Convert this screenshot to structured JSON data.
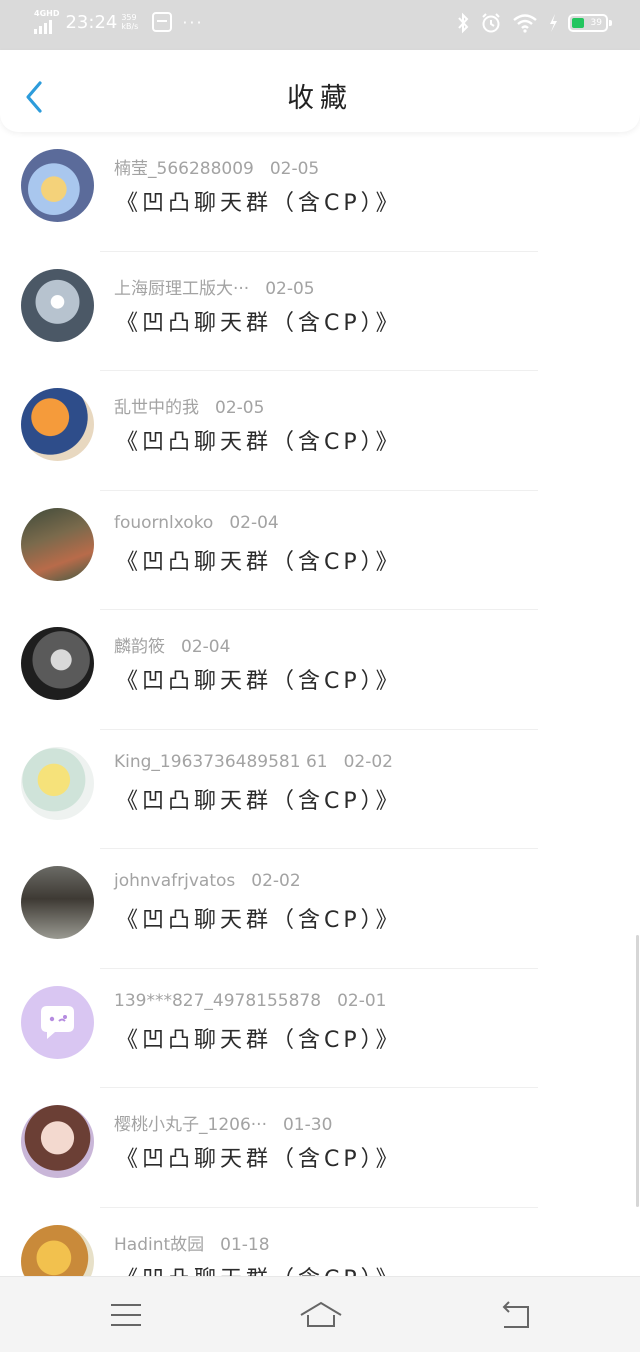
{
  "status_bar": {
    "network": "4GHD",
    "time": "23:24",
    "speed_value": "359",
    "speed_unit": "kB/s",
    "more": "···",
    "battery_level": "39",
    "battery_fraction": 0.39,
    "icons": [
      "signal-icon",
      "sim-card-icon",
      "bluetooth-icon",
      "alarm-icon",
      "wifi-icon",
      "charging-icon",
      "battery-icon"
    ]
  },
  "header": {
    "title": "收藏",
    "back_icon": "chevron-left-icon"
  },
  "colors": {
    "accent": "#2d9cdb",
    "status_bar_bg": "#dadada",
    "battery_fill": "#22c55e",
    "meta_text": "#a3a3a3",
    "message_text": "#2b2b2b"
  },
  "favorites": [
    {
      "name": "楠莹_566288009",
      "date": "02-05",
      "message": "《凹凸聊天群（含CP）》"
    },
    {
      "name": "上海厨理工版大···",
      "date": "02-05",
      "message": "《凹凸聊天群（含CP）》"
    },
    {
      "name": "乱世中的我",
      "date": "02-05",
      "message": "《凹凸聊天群（含CP）》"
    },
    {
      "name": "fouornlxoko",
      "date": "02-04",
      "message": "《凹凸聊天群（含CP）》"
    },
    {
      "name": "麟韵筱",
      "date": "02-04",
      "message": "《凹凸聊天群（含CP）》"
    },
    {
      "name": "King_1963736489581 61",
      "date": "02-02",
      "message": "《凹凸聊天群（含CP）》"
    },
    {
      "name": "johnvafrjvatos",
      "date": "02-02",
      "message": "《凹凸聊天群（含CP）》"
    },
    {
      "name": "139***827_4978155878",
      "date": "02-01",
      "message": "《凹凸聊天群（含CP）》"
    },
    {
      "name": "樱桃小丸子_1206···",
      "date": "01-30",
      "message": "《凹凸聊天群（含CP）》"
    },
    {
      "name": "Hadint故园",
      "date": "01-18",
      "message": "《凹凸聊天群（含CP）》"
    }
  ],
  "nav_bar": {
    "icons": [
      "menu-icon",
      "home-icon",
      "back-arrow-icon"
    ]
  }
}
